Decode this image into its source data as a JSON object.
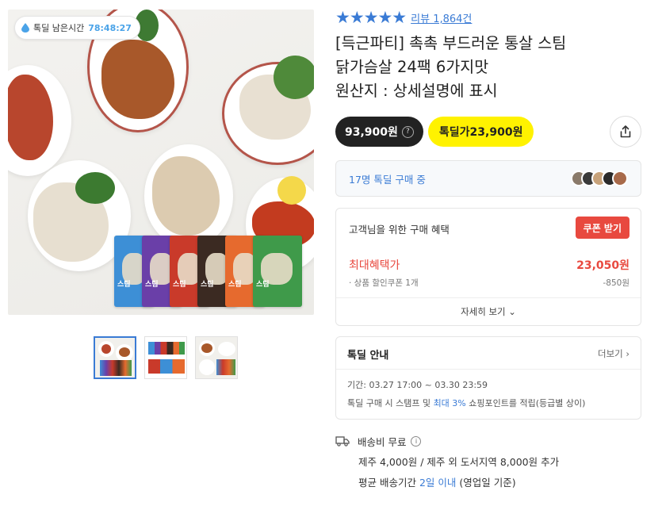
{
  "timer": {
    "label": "톡딜 남은시간",
    "time": "78:48:27"
  },
  "rating": {
    "stars": "★★★★★",
    "review_text": "리뷰 1,864건"
  },
  "product": {
    "title": "[득근파티] 촉촉 부드러운 통살 스팀\n닭가슴살 24팩 6가지맛\n원산지 : 상세설명에 표시",
    "normal_price": "93,900원",
    "deal_price": "톡딜가23,900원"
  },
  "buyers": {
    "text": "17명 톡딜 구매 중"
  },
  "benefit": {
    "heading": "고객님을 위한 구매 혜택",
    "coupon_button": "쿠폰 받기",
    "max_label": "최대혜택가",
    "max_value": "23,050원",
    "coupon_label": "· 상품 할인쿠폰 1개",
    "coupon_value": "-850원",
    "more": "자세히 보기 ⌄"
  },
  "deal_info": {
    "heading": "톡딜 안내",
    "more": "더보기 ›",
    "period": "기간: 03.27 17:00 ~ 03.30 23:59",
    "note_prefix": "톡딜 구매 시 스탬프 및 ",
    "note_highlight": "최대 3%",
    "note_suffix": " 쇼핑포인트를 적립(등급별 상이)"
  },
  "shipping": {
    "label": "배송비 무료",
    "extra": "제주 4,000원 / 제주 외 도서지역 8,000원 추가",
    "avg_prefix": "평균 배송기간 ",
    "avg_highlight": "2일 이내",
    "avg_suffix": " (영업일 기준)"
  },
  "pack_label": "스팀",
  "colors": {
    "accent_blue": "#3a7bd5",
    "deal_yellow": "#fff200",
    "coupon_red": "#e8493f",
    "dark_pill": "#222222"
  },
  "icons": [
    "droplet-icon",
    "question-icon",
    "share-icon",
    "info-icon",
    "truck-icon"
  ]
}
